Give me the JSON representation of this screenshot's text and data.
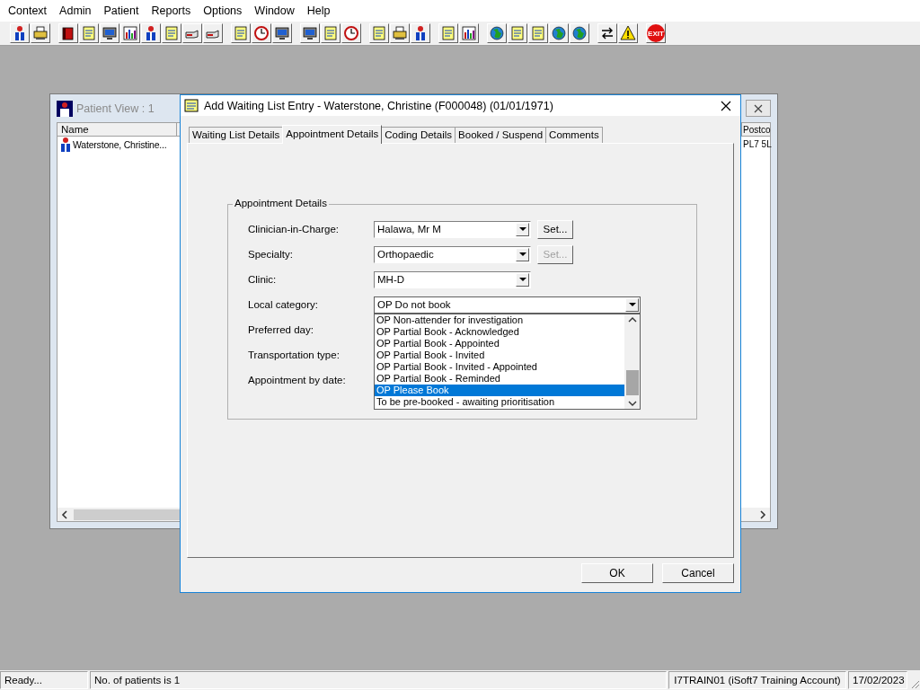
{
  "menu": [
    "Context",
    "Admin",
    "Patient",
    "Reports",
    "Options",
    "Window",
    "Help"
  ],
  "toolbar": {
    "exit_label": "EXIT"
  },
  "patient_window": {
    "title": "Patient View : 1",
    "columns": [
      "Name",
      "Postco"
    ],
    "rows": [
      {
        "name": "Waterstone, Christine...",
        "postcode": "PL7 5L"
      }
    ]
  },
  "dialog": {
    "title": "Add Waiting List Entry - Waterstone, Christine (F000048) (01/01/1971)",
    "tabs": [
      {
        "label": "Waiting List Details",
        "selected": false
      },
      {
        "label": "Appointment Details",
        "selected": true
      },
      {
        "label": "Coding Details",
        "selected": false
      },
      {
        "label": "Booked / Suspend",
        "selected": false
      },
      {
        "label": "Comments",
        "selected": false
      }
    ],
    "group_title": "Appointment Details",
    "fields": [
      {
        "label": "Clinician-in-Charge:",
        "kind": "combo",
        "value": "Halawa, Mr M",
        "button": {
          "label": "Set...",
          "disabled": false
        }
      },
      {
        "label": "Specialty:",
        "kind": "combo",
        "value": "Orthopaedic",
        "button": {
          "label": "Set...",
          "disabled": true
        }
      },
      {
        "label": "Clinic:",
        "kind": "combo",
        "value": "MH-D"
      },
      {
        "label": "Local category:",
        "kind": "wide-combo",
        "value": "OP Do not book",
        "expanded": true
      },
      {
        "label": "Preferred day:",
        "kind": "covered"
      },
      {
        "label": "Transportation type:",
        "kind": "covered"
      },
      {
        "label": "Appointment by date:",
        "kind": "covered"
      }
    ],
    "dropdown_options": [
      {
        "label": "OP Non-attender for investigation",
        "selected": false
      },
      {
        "label": "OP Partial Book - Acknowledged",
        "selected": false
      },
      {
        "label": "OP Partial Book - Appointed",
        "selected": false
      },
      {
        "label": "OP Partial Book - Invited",
        "selected": false
      },
      {
        "label": "OP Partial Book - Invited - Appointed",
        "selected": false
      },
      {
        "label": "OP Partial Book - Reminded",
        "selected": false
      },
      {
        "label": "OP Please Book",
        "selected": true
      },
      {
        "label": "To be pre-booked - awaiting prioritisation",
        "selected": false
      }
    ],
    "buttons": [
      "OK",
      "Cancel"
    ]
  },
  "status_bar": [
    "Ready...",
    "No. of patients is 1",
    "I7TRAIN01 (iSoft7 Training Account)",
    "17/02/2023"
  ]
}
